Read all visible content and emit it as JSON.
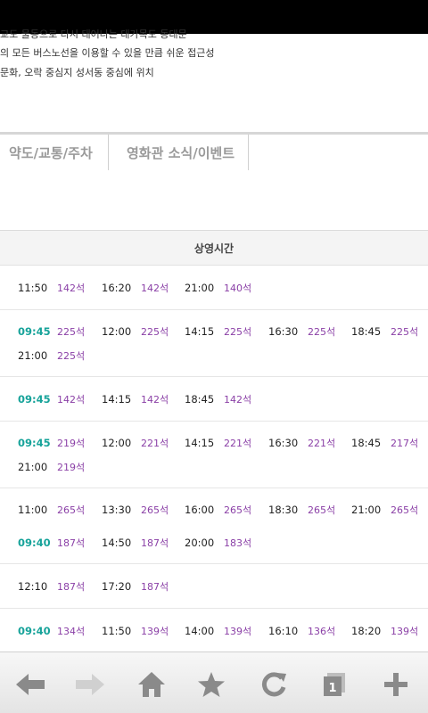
{
  "info": {
    "lines": [
      "교도 물동으로 다시 태어나는 대가목도 동대문",
      "의 모든 버스노선을 이용할 수 있을 만큼 쉬운 접근성",
      "문화, 오락 중심지 성서동 중심에 위치"
    ]
  },
  "tabs": {
    "traffic": "약도/교통/주차",
    "news": "영화관 소식/이벤트"
  },
  "schedule": {
    "title": "상영시간",
    "rows": [
      {
        "lines": [
          [
            {
              "time": "11:50",
              "seats": "142석"
            },
            {
              "time": "16:20",
              "seats": "142석"
            },
            {
              "time": "21:00",
              "seats": "140석"
            }
          ]
        ]
      },
      {
        "lines": [
          [
            {
              "time": "09:45",
              "seats": "225석",
              "early": true
            },
            {
              "time": "12:00",
              "seats": "225석"
            },
            {
              "time": "14:15",
              "seats": "225석"
            },
            {
              "time": "16:30",
              "seats": "225석"
            },
            {
              "time": "18:45",
              "seats": "225석"
            }
          ],
          [
            {
              "time": "21:00",
              "seats": "225석"
            }
          ]
        ]
      },
      {
        "lines": [
          [
            {
              "time": "09:45",
              "seats": "142석",
              "early": true
            },
            {
              "time": "14:15",
              "seats": "142석"
            },
            {
              "time": "18:45",
              "seats": "142석"
            }
          ]
        ]
      },
      {
        "lines": [
          [
            {
              "time": "09:45",
              "seats": "219석",
              "early": true
            },
            {
              "time": "12:00",
              "seats": "221석"
            },
            {
              "time": "14:15",
              "seats": "221석"
            },
            {
              "time": "16:30",
              "seats": "221석"
            },
            {
              "time": "18:45",
              "seats": "217석"
            }
          ],
          [
            {
              "time": "21:00",
              "seats": "219석"
            }
          ]
        ]
      },
      {
        "lines": [
          [
            {
              "time": "11:00",
              "seats": "265석"
            },
            {
              "time": "13:30",
              "seats": "265석"
            },
            {
              "time": "16:00",
              "seats": "265석"
            },
            {
              "time": "18:30",
              "seats": "265석"
            },
            {
              "time": "21:00",
              "seats": "265석"
            }
          ],
          [
            {
              "time": "09:40",
              "seats": "187석",
              "early": true
            },
            {
              "time": "14:50",
              "seats": "187석"
            },
            {
              "time": "20:00",
              "seats": "183석"
            }
          ]
        ]
      },
      {
        "lines": [
          [
            {
              "time": "12:10",
              "seats": "187석"
            },
            {
              "time": "17:20",
              "seats": "187석"
            }
          ]
        ]
      },
      {
        "lines": [
          [
            {
              "time": "09:40",
              "seats": "134석",
              "early": true
            },
            {
              "time": "11:50",
              "seats": "139석"
            },
            {
              "time": "14:00",
              "seats": "139석"
            },
            {
              "time": "16:10",
              "seats": "136석"
            },
            {
              "time": "18:20",
              "seats": "139석"
            }
          ]
        ]
      }
    ]
  },
  "toolbar": {
    "buttons": [
      {
        "name": "back-button",
        "icon": "back-arrow-icon",
        "enabled": true
      },
      {
        "name": "forward-button",
        "icon": "forward-arrow-icon",
        "enabled": false
      },
      {
        "name": "home-button",
        "icon": "home-icon",
        "enabled": true
      },
      {
        "name": "bookmark-button",
        "icon": "star-icon",
        "enabled": true
      },
      {
        "name": "refresh-button",
        "icon": "refresh-icon",
        "enabled": true
      },
      {
        "name": "windows-button",
        "icon": "windows-icon",
        "enabled": true
      },
      {
        "name": "new-tab-button",
        "icon": "plus-icon",
        "enabled": true
      }
    ],
    "window_count": "1"
  },
  "colors": {
    "early_time": "#17a39a",
    "seats": "#8a3fa6",
    "icon": "#8a8a8a",
    "icon_disabled": "#cfcfcf"
  }
}
